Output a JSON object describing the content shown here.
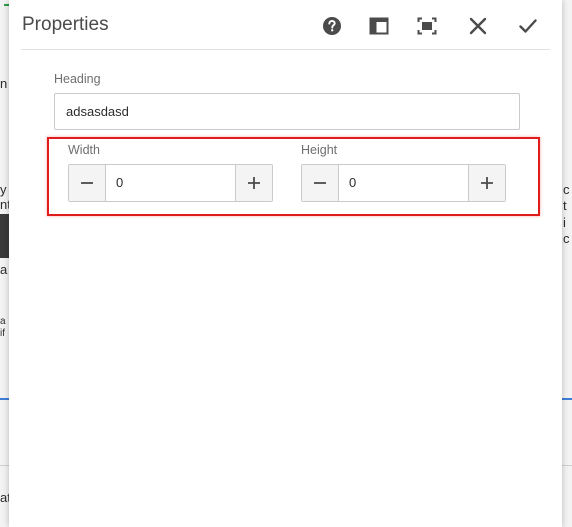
{
  "dialog": {
    "title": "Properties",
    "header_buttons": [
      {
        "name": "help",
        "icon": "help-circle-icon"
      },
      {
        "name": "panel",
        "icon": "sidebar-panel-icon"
      },
      {
        "name": "fullscreen",
        "icon": "fullscreen-icon"
      },
      {
        "name": "close",
        "icon": "close-icon"
      },
      {
        "name": "confirm",
        "icon": "checkmark-icon"
      }
    ]
  },
  "form": {
    "heading": {
      "label": "Heading",
      "value": "adsasdasd"
    },
    "width": {
      "label": "Width",
      "value": "0"
    },
    "height": {
      "label": "Height",
      "value": "0"
    }
  },
  "colors": {
    "highlight": "#e01b1b",
    "icon": "#4b4b4b"
  }
}
